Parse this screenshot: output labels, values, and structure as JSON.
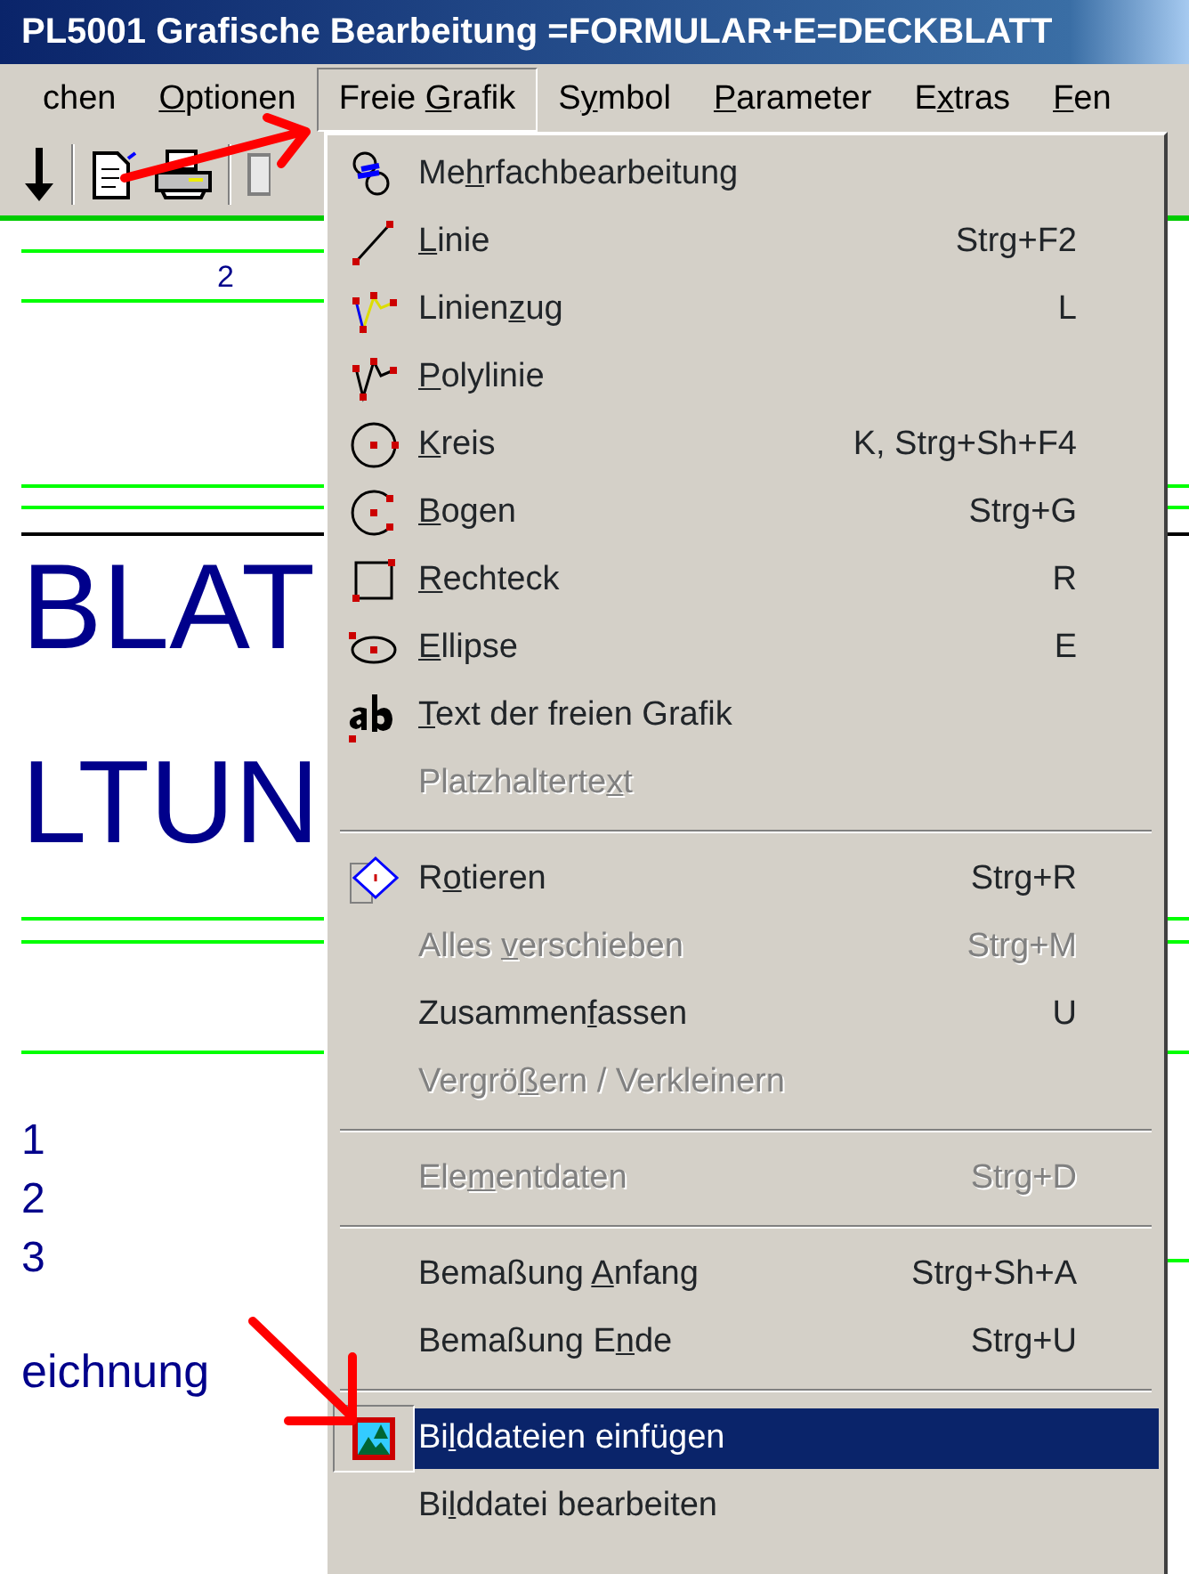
{
  "window": {
    "title": "PL5001 Grafische Bearbeitung =FORMULAR+E=DECKBLATT"
  },
  "menubar": [
    {
      "before": "chen",
      "selected": false
    },
    {
      "key": "O",
      "after": "ptionen",
      "selected": false
    },
    {
      "before": "Freie ",
      "key": "G",
      "after": "rafik",
      "selected": true
    },
    {
      "before": "S",
      "key": "y",
      "after": "mbol",
      "selected": false
    },
    {
      "key": "P",
      "after": "arameter",
      "selected": false
    },
    {
      "before": "E",
      "key": "x",
      "after": "tras",
      "selected": false
    },
    {
      "key": "F",
      "after": "en",
      "selected": false
    }
  ],
  "sheet": {
    "texts": [
      "2",
      "BLAT",
      "LTUN",
      "1",
      "2",
      "3",
      "eichnung"
    ]
  },
  "menu": [
    {
      "kind": "item",
      "before": "Me",
      "key": "h",
      "after": "rfachbearbeitung",
      "disabled": false,
      "selected": false
    },
    {
      "kind": "item",
      "key": "L",
      "after": "inie",
      "shortcut": "Strg+F2",
      "disabled": false,
      "selected": false
    },
    {
      "kind": "item",
      "before": "Linien",
      "key": "z",
      "after": "ug",
      "shortcut": "L",
      "disabled": false,
      "selected": false
    },
    {
      "kind": "item",
      "key": "P",
      "after": "olylinie",
      "disabled": false,
      "selected": false
    },
    {
      "kind": "item",
      "key": "K",
      "after": "reis",
      "shortcut": "K, Strg+Sh+F4",
      "disabled": false,
      "selected": false
    },
    {
      "kind": "item",
      "key": "B",
      "after": "ogen",
      "shortcut": "Strg+G",
      "disabled": false,
      "selected": false
    },
    {
      "kind": "item",
      "key": "R",
      "after": "echteck",
      "shortcut": "R",
      "disabled": false,
      "selected": false
    },
    {
      "kind": "item",
      "key": "E",
      "after": "llipse",
      "shortcut": "E",
      "disabled": false,
      "selected": false
    },
    {
      "kind": "item",
      "key": "T",
      "after": "ext der freien Grafik",
      "disabled": false,
      "selected": false
    },
    {
      "kind": "item",
      "before": "Platzhalterte",
      "key": "x",
      "after": "t",
      "disabled": true,
      "selected": false
    },
    {
      "kind": "separator"
    },
    {
      "kind": "item",
      "before": "R",
      "key": "o",
      "after": "tieren",
      "shortcut": "Strg+R",
      "disabled": false,
      "selected": false
    },
    {
      "kind": "item",
      "before": "Alles ",
      "key": "v",
      "after": "erschieben",
      "shortcut": "Strg+M",
      "disabled": true,
      "selected": false
    },
    {
      "kind": "item",
      "before": "Zusammen",
      "key": "f",
      "after": "assen",
      "shortcut": "U",
      "disabled": false,
      "selected": false
    },
    {
      "kind": "item",
      "before": "Vergrö",
      "key": "ß",
      "after": "ern / Verkleinern",
      "disabled": true,
      "selected": false
    },
    {
      "kind": "separator"
    },
    {
      "kind": "item",
      "before": "Ele",
      "key": "m",
      "after": "entdaten",
      "shortcut": "Strg+D",
      "disabled": true,
      "selected": false
    },
    {
      "kind": "separator"
    },
    {
      "kind": "item",
      "before": "Bemaßung ",
      "key": "A",
      "after": "nfang",
      "shortcut": "Strg+Sh+A",
      "disabled": false,
      "selected": false
    },
    {
      "kind": "item",
      "before": "Bemaßung E",
      "key": "n",
      "after": "de",
      "shortcut": "Strg+U",
      "disabled": false,
      "selected": false
    },
    {
      "kind": "separator"
    },
    {
      "kind": "item",
      "before": "Bi",
      "key": "l",
      "after": "ddateien einfügen",
      "disabled": false,
      "selected": true
    },
    {
      "kind": "item",
      "before": "Bi",
      "key": "l",
      "after": "ddatei bearbeiten",
      "disabled": false,
      "selected": false
    }
  ]
}
